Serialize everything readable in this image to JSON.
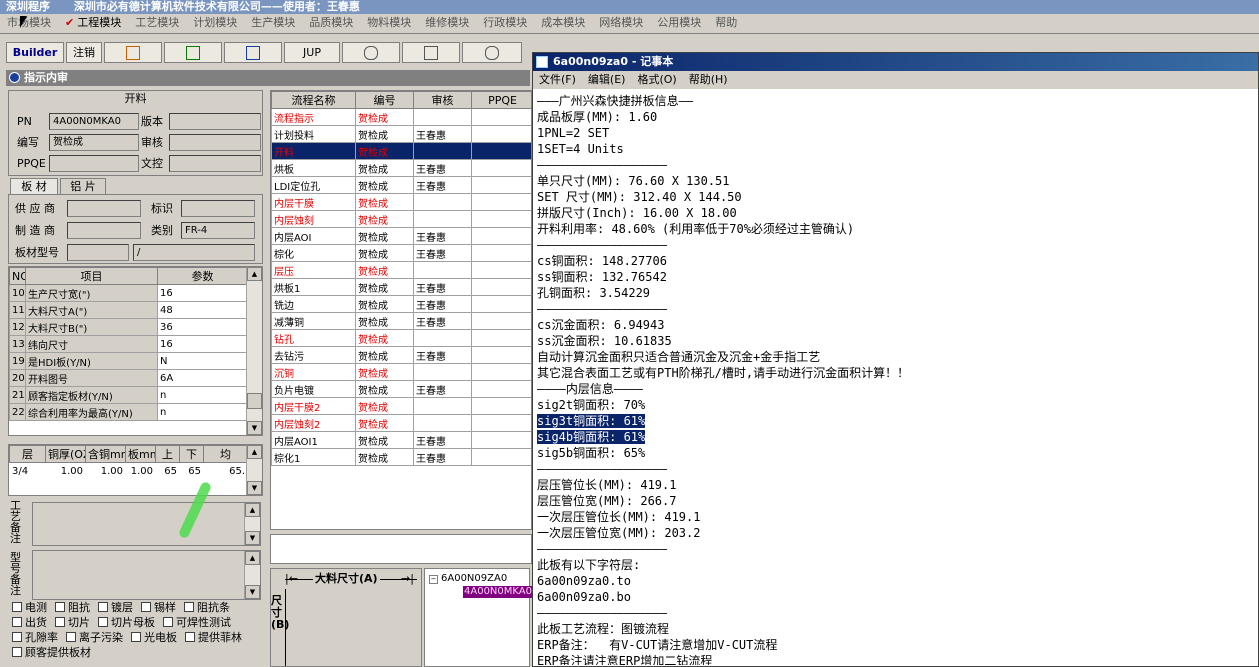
{
  "app": {
    "title_program": "深圳程序",
    "title_company": "深圳市必有德计算机软件技术有限公司——使用者：王春惠"
  },
  "menus": [
    "市场模块",
    "工程模块",
    "工艺模块",
    "计划模块",
    "生产模块",
    "品质模块",
    "物料模块",
    "维修模块",
    "行政模块",
    "成本模块",
    "网络模块",
    "公用模块",
    "帮助"
  ],
  "toolbar": {
    "builder": "Builder",
    "cancel": "注销",
    "jup": "JUP"
  },
  "panel": {
    "title": "指示内审"
  },
  "kailiao": {
    "header": "开料",
    "pn_label": "PN",
    "pn_value": "4A00N0MKA0",
    "version_label": "版本",
    "version_value": "",
    "author_label": "编写",
    "author_value": "贺检成",
    "review_label": "审核",
    "review_value": "",
    "ppqe_label": "PPQE",
    "ppqe_value": "",
    "doc_label": "文控",
    "doc_value": ""
  },
  "tabs": [
    "板 材",
    "铝 片"
  ],
  "board": {
    "supplier_label": "供 应 商",
    "supplier_value": "",
    "mark_label": "标识",
    "mark_value": "",
    "maker_label": "制 造 商",
    "maker_value": "",
    "category_label": "类别",
    "category_value": "FR-4",
    "model_label": "板材型号",
    "model_value": "",
    "model_value2": "/"
  },
  "params": {
    "headers": [
      "NO",
      "项目",
      "参数"
    ],
    "rows": [
      {
        "no": "10",
        "item": "生产尺寸宽(\")",
        "value": "16"
      },
      {
        "no": "11",
        "item": "大料尺寸A(\")",
        "value": "48"
      },
      {
        "no": "12",
        "item": "大料尺寸B(\")",
        "value": "36"
      },
      {
        "no": "13",
        "item": "纬向尺寸",
        "value": "16"
      },
      {
        "no": "19",
        "item": "是HDI板(Y/N)",
        "value": "N"
      },
      {
        "no": "20",
        "item": "开料图号",
        "value": "6A"
      },
      {
        "no": "21",
        "item": "顾客指定板材(Y/N)",
        "value": "n"
      },
      {
        "no": "22",
        "item": "综合利用率为最高(Y/N)",
        "value": "n"
      }
    ]
  },
  "layers": {
    "headers": [
      "层",
      "铜厚(OZ)",
      "含铜mm",
      "板mm",
      "上",
      "下",
      "均"
    ],
    "rows": [
      {
        "c0": "3/4",
        "c1": "1.00",
        "c2": "1.00",
        "c3": "1.00",
        "c4": "65",
        "c5": "65",
        "c6": "65."
      }
    ]
  },
  "remarks": {
    "process": "工艺备注",
    "model": "型号备注"
  },
  "checkboxes": [
    [
      "电测",
      "阻抗",
      "镀层",
      "锡样",
      "阻抗条"
    ],
    [
      "出货",
      "切片",
      "切片母板",
      "可焊性测试"
    ],
    [
      "孔隙率",
      "离子污染",
      "光电板",
      "提供菲林"
    ],
    [
      "顾客提供板材"
    ]
  ],
  "flow": {
    "headers": [
      "流程名称",
      "编号",
      "审核",
      "PPQE"
    ],
    "rows": [
      {
        "name": "流程指示",
        "no": "贺检成",
        "review": "",
        "red": true
      },
      {
        "name": "计划投料",
        "no": "贺检成",
        "review": "王春惠",
        "red": false
      },
      {
        "name": "开料",
        "no": "贺检成",
        "review": "",
        "red": true,
        "selected": true
      },
      {
        "name": "烘板",
        "no": "贺检成",
        "review": "王春惠",
        "red": false
      },
      {
        "name": "LDI定位孔",
        "no": "贺检成",
        "review": "王春惠",
        "red": false
      },
      {
        "name": "内层干膜",
        "no": "贺检成",
        "review": "",
        "red": true
      },
      {
        "name": "内层蚀刻",
        "no": "贺检成",
        "review": "",
        "red": true
      },
      {
        "name": "内层AOI",
        "no": "贺检成",
        "review": "王春惠",
        "red": false
      },
      {
        "name": "棕化",
        "no": "贺检成",
        "review": "王春惠",
        "red": false
      },
      {
        "name": "层压",
        "no": "贺检成",
        "review": "",
        "red": true
      },
      {
        "name": "烘板1",
        "no": "贺检成",
        "review": "王春惠",
        "red": false
      },
      {
        "name": "铣边",
        "no": "贺检成",
        "review": "王春惠",
        "red": false
      },
      {
        "name": "减薄铜",
        "no": "贺检成",
        "review": "王春惠",
        "red": false
      },
      {
        "name": "钻孔",
        "no": "贺检成",
        "review": "",
        "red": true
      },
      {
        "name": "去钻污",
        "no": "贺检成",
        "review": "王春惠",
        "red": false
      },
      {
        "name": "沉铜",
        "no": "贺检成",
        "review": "",
        "red": true
      },
      {
        "name": "负片电镀",
        "no": "贺检成",
        "review": "王春惠",
        "red": false
      },
      {
        "name": "内层干膜2",
        "no": "贺检成",
        "review": "",
        "red": true
      },
      {
        "name": "内层蚀刻2",
        "no": "贺检成",
        "review": "",
        "red": true
      },
      {
        "name": "内层AOI1",
        "no": "贺检成",
        "review": "王春惠",
        "red": false
      },
      {
        "name": "棕化1",
        "no": "贺检成",
        "review": "王春惠",
        "red": false
      }
    ]
  },
  "diagram": {
    "label_a": "大料尺寸(A)",
    "label_b": "尺寸(B)"
  },
  "tree": {
    "root": "6A00N09ZA0",
    "child": "4A00N0MKA0"
  },
  "notepad": {
    "title": "6a00n09za0 - 记事本",
    "menu": [
      "文件(F)",
      "编辑(E)",
      "格式(O)",
      "帮助(H)"
    ],
    "lines": [
      "———广州兴森快捷拼板信息——",
      "成品板厚(MM): 1.60",
      "1PNL=2 SET",
      "1SET=4 Units",
      "——————————————————",
      "单只尺寸(MM): 76.60 X 130.51",
      "SET 尺寸(MM): 312.40 X 144.50",
      "拼版尺寸(Inch): 16.00 X 18.00",
      "开料利用率: 48.60% (利用率低于70%必须经过主管确认)",
      "——————————————————",
      "cs铜面积: 148.27706",
      "ss铜面积: 132.76542",
      "孔铜面积: 3.54229",
      "——————————————————",
      "cs沉金面积: 6.94943",
      "ss沉金面积: 10.61835",
      "自动计算沉金面积只适合普通沉金及沉金+金手指工艺",
      "其它混合表面工艺或有PTH阶梯孔/槽时,请手动进行沉金面积计算！！",
      "————内层信息————",
      "sig2t铜面积: 70%",
      "sig3t铜面积: 61%",
      "sig4b铜面积: 61%",
      "sig5b铜面积: 65%",
      "——————————————————",
      "层压管位长(MM): 419.1",
      "层压管位宽(MM): 266.7",
      "一次层压管位长(MM): 419.1",
      "一次层压管位宽(MM): 203.2",
      "——————————————————",
      "此板有以下字符层:",
      "6a00n09za0.to",
      "6a00n09za0.bo",
      "——————————————————",
      "此板工艺流程：图镀流程",
      "ERP备注：  有V-CUT请注意增加V-CUT流程",
      "ERP备注请注意ERP增加二钻流程"
    ],
    "highlight_lines": [
      20,
      21
    ]
  }
}
